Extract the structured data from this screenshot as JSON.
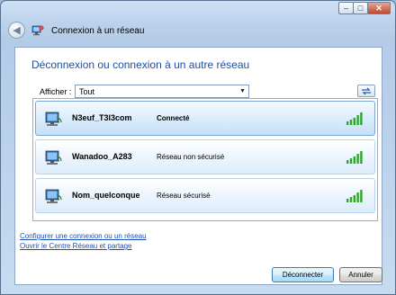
{
  "window": {
    "title": "Connexion à un réseau",
    "controls": {
      "minimize": "–",
      "maximize": "□",
      "close": "✕"
    }
  },
  "content": {
    "heading": "Déconnexion ou connexion à un autre réseau",
    "filter": {
      "label": "Afficher :",
      "value": "Tout"
    }
  },
  "networks": [
    {
      "name": "N3euf_T3l3com",
      "status": "Connecté",
      "selected": true,
      "signal_bars": 5
    },
    {
      "name": "Wanadoo_A283",
      "status": "Réseau non sécurisé",
      "selected": false,
      "signal_bars": 5
    },
    {
      "name": "Nom_quelconque",
      "status": "Réseau sécurisé",
      "selected": false,
      "signal_bars": 5
    }
  ],
  "links": {
    "configure": "Configurer une connexion ou un réseau",
    "network_center": "Ouvrir le Centre Réseau et partage"
  },
  "buttons": {
    "disconnect": "Déconnecter",
    "cancel": "Annuler"
  },
  "colors": {
    "heading": "#1e4f9b",
    "link": "#1b4fb3",
    "signal_green": "#2fa52a"
  }
}
